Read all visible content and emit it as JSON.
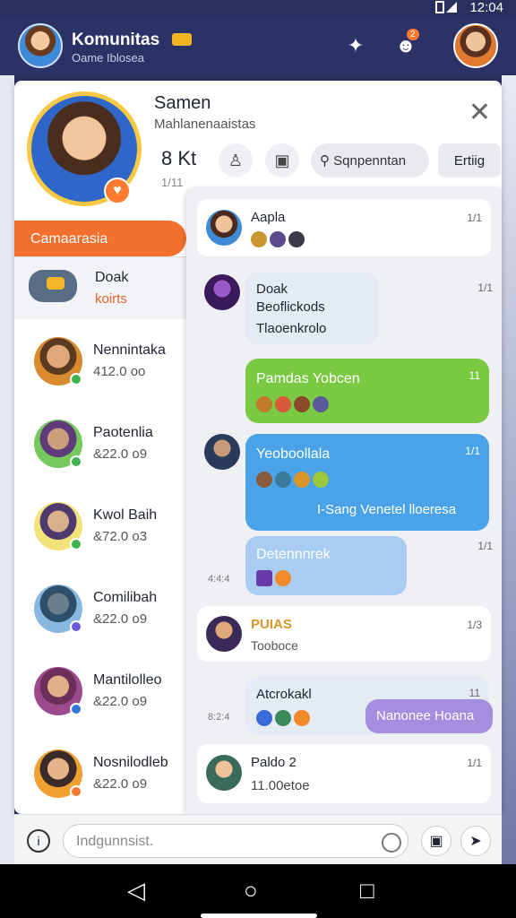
{
  "status": {
    "time": "12:04"
  },
  "header": {
    "title": "Komunitas",
    "subtitle": "Oame Iblosea",
    "badge": "2"
  },
  "profile": {
    "name": "Samen",
    "desc": "Mahlanenaaistas",
    "stat": "8 Kt",
    "stat2": "1/11",
    "search": "Sqnpenntan",
    "edit": "Ertiig"
  },
  "category": "Camaarasia",
  "game_card": {
    "title": "Doak",
    "sub": "koirts"
  },
  "contacts": [
    {
      "name": "Nennintaka",
      "value": "412.0 oo"
    },
    {
      "name": "Paotenlia",
      "value": "&22.0 o9"
    },
    {
      "name": "Kwol Baih",
      "value": "&72.0 o3"
    },
    {
      "name": "Comilibah",
      "value": "&22.0 o9"
    },
    {
      "name": "Mantilolleo",
      "value": "&22.0 o9"
    },
    {
      "name": "Nosnilodleb",
      "value": "&22.0 o9"
    }
  ],
  "messages": [
    {
      "name": "Aapla",
      "time": "1/1"
    },
    {
      "name": "Doak",
      "text": "Beoflickods",
      "text2": "Tlaoenkrolo",
      "time": "1/1"
    },
    {
      "text": "Pamdas Yobcen",
      "time": "11"
    },
    {
      "text": "Yeoboollala",
      "text2": "I-Sang Venetel lloeresa",
      "time": "1/1"
    },
    {
      "text": "Detennnrek",
      "side": "4:4:4",
      "time": "1/1"
    },
    {
      "name": "PUIAS",
      "text": "Tooboce",
      "time": "1/3"
    },
    {
      "name": "Atcrokakl",
      "side": "8:2:4",
      "bubble": "Nanonee Hoana",
      "time": "11"
    },
    {
      "name": "Paldo 2",
      "text": "11.00etoe",
      "time": "1/1"
    }
  ],
  "input": {
    "placeholder": "Indgunnsist."
  },
  "colors": {
    "accent": "#f36f2d",
    "green": "#7ac943",
    "blue": "#4aa3e8",
    "lightblue": "#a9cdf2",
    "purple": "#a58de0",
    "header": "#2b3266"
  }
}
